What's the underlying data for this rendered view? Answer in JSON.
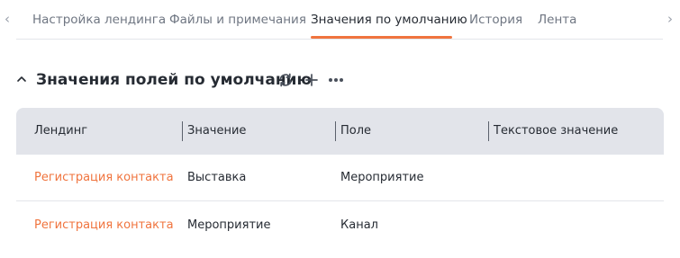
{
  "tabs": {
    "items": [
      {
        "label": "Настройка лендинга"
      },
      {
        "label": "Файлы и примечания"
      },
      {
        "label": "Значения по умолчанию"
      },
      {
        "label": "История"
      },
      {
        "label": "Лента"
      }
    ],
    "active_index": 2
  },
  "nav": {
    "left_icon": "chevron-left-icon",
    "right_icon": "chevron-right-icon"
  },
  "section": {
    "title": "Значения полей по умолчанию",
    "icons": [
      "chevron-up-icon",
      "refresh-icon",
      "plus-icon",
      "more-icon"
    ]
  },
  "grid": {
    "columns": [
      "Лендинг",
      "Значение",
      "Поле",
      "Текстовое значение"
    ],
    "rows": [
      [
        "Регистрация контакта",
        "Выставка",
        "Мероприятие",
        ""
      ],
      [
        "Регистрация контакта",
        "Мероприятие",
        "Канал",
        ""
      ]
    ]
  },
  "colors": {
    "accent": "#f0743e",
    "header_bg": "#e2e4ea",
    "text": "#262b33",
    "muted": "#6f7682"
  }
}
